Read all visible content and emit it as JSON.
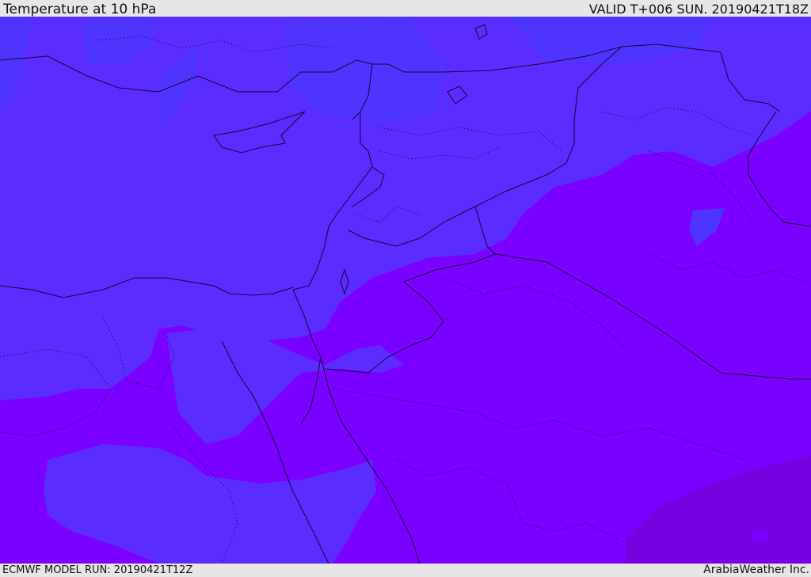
{
  "header": {
    "title": "Temperature at 10 hPa",
    "valid_time": "VALID T+006 SUN. 20190421T18Z"
  },
  "footer": {
    "model_run": "ECMWF MODEL RUN: 20190421T12Z",
    "credit": "ArabiaWeather Inc."
  },
  "map": {
    "colors": {
      "band_warm": "#5b2cff",
      "band_light": "#4f34ff",
      "band_mid": "#6a1aff",
      "band_cool": "#7a00ff",
      "band_dark": "#7500e0",
      "coastline": "#1a0030",
      "border": "#1a0030"
    }
  }
}
